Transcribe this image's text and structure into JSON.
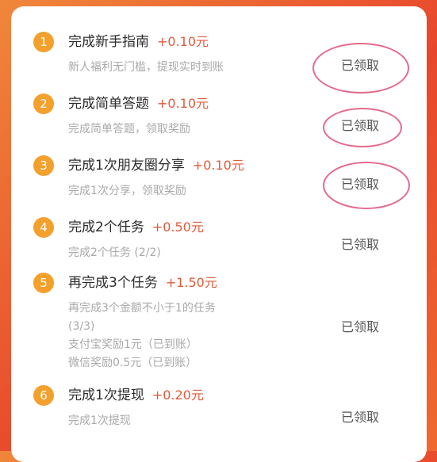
{
  "tasks": [
    {
      "number": "1",
      "title": "完成新手指南",
      "reward": "+0.10元",
      "description": [
        "新人福利无门槛，提现实时到账"
      ],
      "status": "已领取",
      "circled": true
    },
    {
      "number": "2",
      "title": "完成简单答题",
      "reward": "+0.10元",
      "description": [
        "完成简单答题，领取奖励"
      ],
      "status": "已领取",
      "circled": true
    },
    {
      "number": "3",
      "title": "完成1次朋友圈分享",
      "reward": "+0.10元",
      "description": [
        "完成1次分享，领取奖励"
      ],
      "status": "已领取",
      "circled": true
    },
    {
      "number": "4",
      "title": "完成2个任务",
      "reward": "+0.50元",
      "description": [
        "完成2个任务 (2/2)"
      ],
      "status": "已领取",
      "circled": false
    },
    {
      "number": "5",
      "title": "再完成3个任务",
      "reward": "+1.50元",
      "description": [
        "再完成3个金额不小于1的任务",
        "(3/3)",
        "支付宝奖励1元（已到账）",
        "微信奖励0.5元（已到账）"
      ],
      "status": "已领取",
      "circled": false
    },
    {
      "number": "6",
      "title": "完成1次提现",
      "reward": "+0.20元",
      "description": [
        "完成1次提现"
      ],
      "status": "已领取",
      "circled": false
    }
  ],
  "colors": {
    "badge": "#f3a02c",
    "reward": "#e05a3a",
    "ring": "#e56a8c"
  }
}
